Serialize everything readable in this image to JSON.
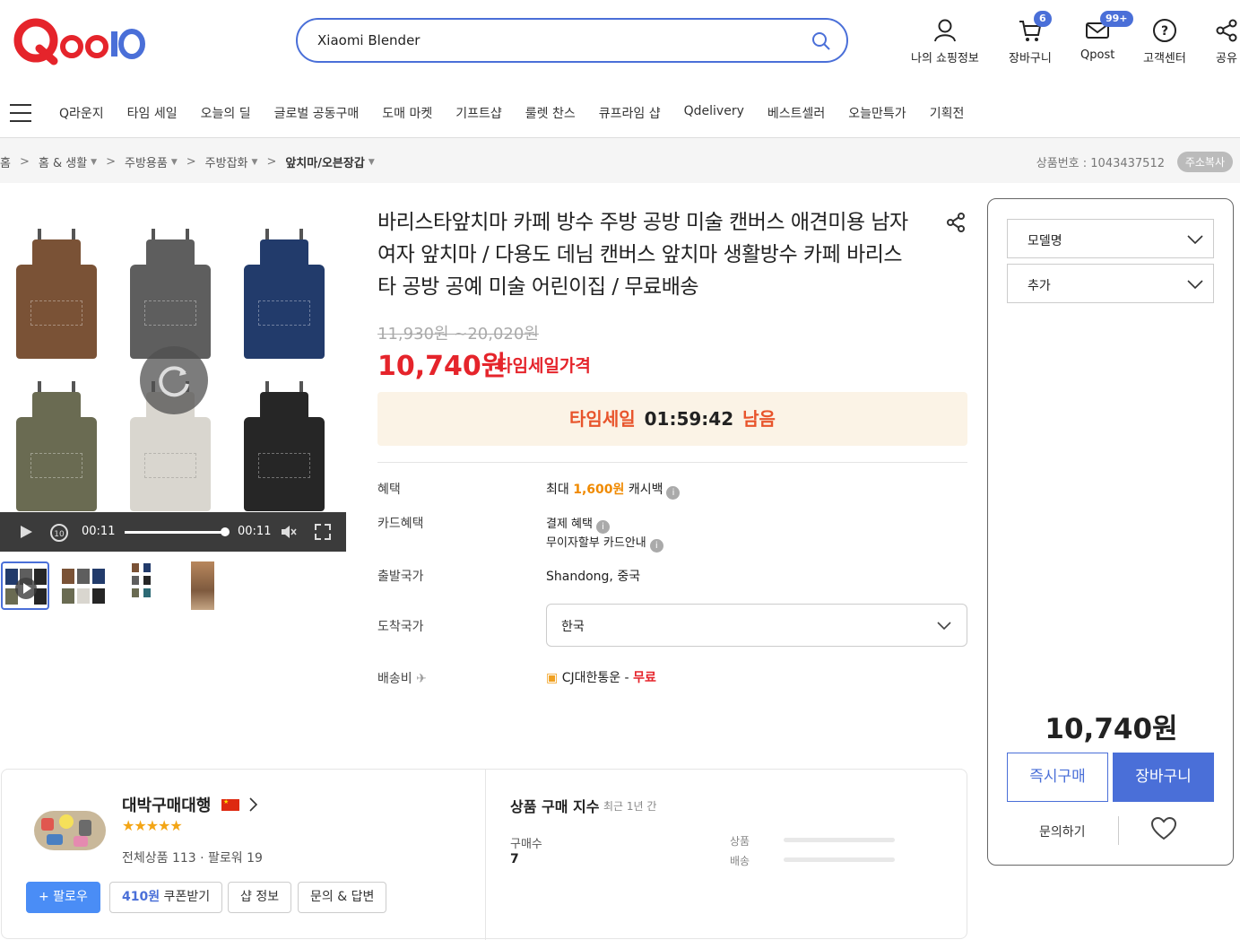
{
  "header": {
    "logo": "Qoo10",
    "search_value": "Xiaomi Blender",
    "items": [
      {
        "label": "나의 쇼핑정보",
        "icon": "user-icon"
      },
      {
        "label": "장바구니",
        "icon": "cart-icon",
        "badge": "6"
      },
      {
        "label": "Qpost",
        "icon": "mail-icon",
        "badge": "99+"
      },
      {
        "label": "고객센터",
        "icon": "help-icon"
      },
      {
        "label": "공유",
        "icon": "share-icon"
      }
    ]
  },
  "nav": {
    "items": [
      "Q라운지",
      "타임 세일",
      "오늘의 딜",
      "글로벌 공동구매",
      "도매 마켓",
      "기프트샵",
      "룰렛 찬스",
      "큐프라임 샵",
      "Qdelivery",
      "베스트셀러",
      "오늘만특가",
      "기획전"
    ]
  },
  "breadcrumb": {
    "items": [
      "홈",
      "홈 & 생활",
      "주방용품",
      "주방잡화",
      "앞치마/오븐장갑"
    ],
    "product_number": "상품번호 : 1043437512",
    "copy_label": "주소복사"
  },
  "video": {
    "current_time": "00:11",
    "duration": "00:11"
  },
  "product": {
    "title": "바리스타앞치마 카페 방수 주방 공방 미술 캔버스 애견미용 남자 여자 앞치마 / 다용도 데님 캔버스 앞치마 생활방수 카페 바리스타 공방 공예 미술 어린이집 / 무료배송",
    "original_price": "11,930원 ~20,020원",
    "price": "10,740원",
    "price_tag": "타임세일가격",
    "timesale_label": "타임세일",
    "timesale_time": "01:59:42",
    "timesale_suffix": "남음",
    "benefit_label": "혜택",
    "benefit_prefix": "최대",
    "benefit_amount": "1,600원",
    "benefit_suffix": "캐시백",
    "card_label": "카드혜택",
    "card_line1": "결제 혜택",
    "card_line2": "무이자할부 카드안내",
    "origin_label": "출발국가",
    "origin_value": "Shandong, 중국",
    "dest_label": "도착국가",
    "dest_value": "한국",
    "ship_label": "배송비",
    "ship_carrier": "CJ대한통운 - ",
    "ship_free": "무료"
  },
  "panel": {
    "option1": "모델명",
    "option2": "추가",
    "total": "10,740원",
    "buy_now": "즉시구매",
    "add_cart": "장바구니",
    "inquiry": "문의하기"
  },
  "seller": {
    "name": "대박구매대행",
    "stars": "★★★★★",
    "stats": "전체상품 113 · 팔로워 19",
    "follow": "+ 팔로우",
    "coupon_amount": "410원",
    "coupon_label": " 쿠폰받기",
    "shop_info": "샵 정보",
    "qna": "문의 & 답변",
    "index_title": "상품 구매 지수",
    "index_sub": "최근 1년 간",
    "buy_count_label": "구매수",
    "buy_count": "7",
    "bar1": "상품",
    "bar2": "배송"
  },
  "colors": {
    "accent": "#4a6fd8",
    "sale_red": "#e5242b",
    "cashback_orange": "#f08a00"
  }
}
